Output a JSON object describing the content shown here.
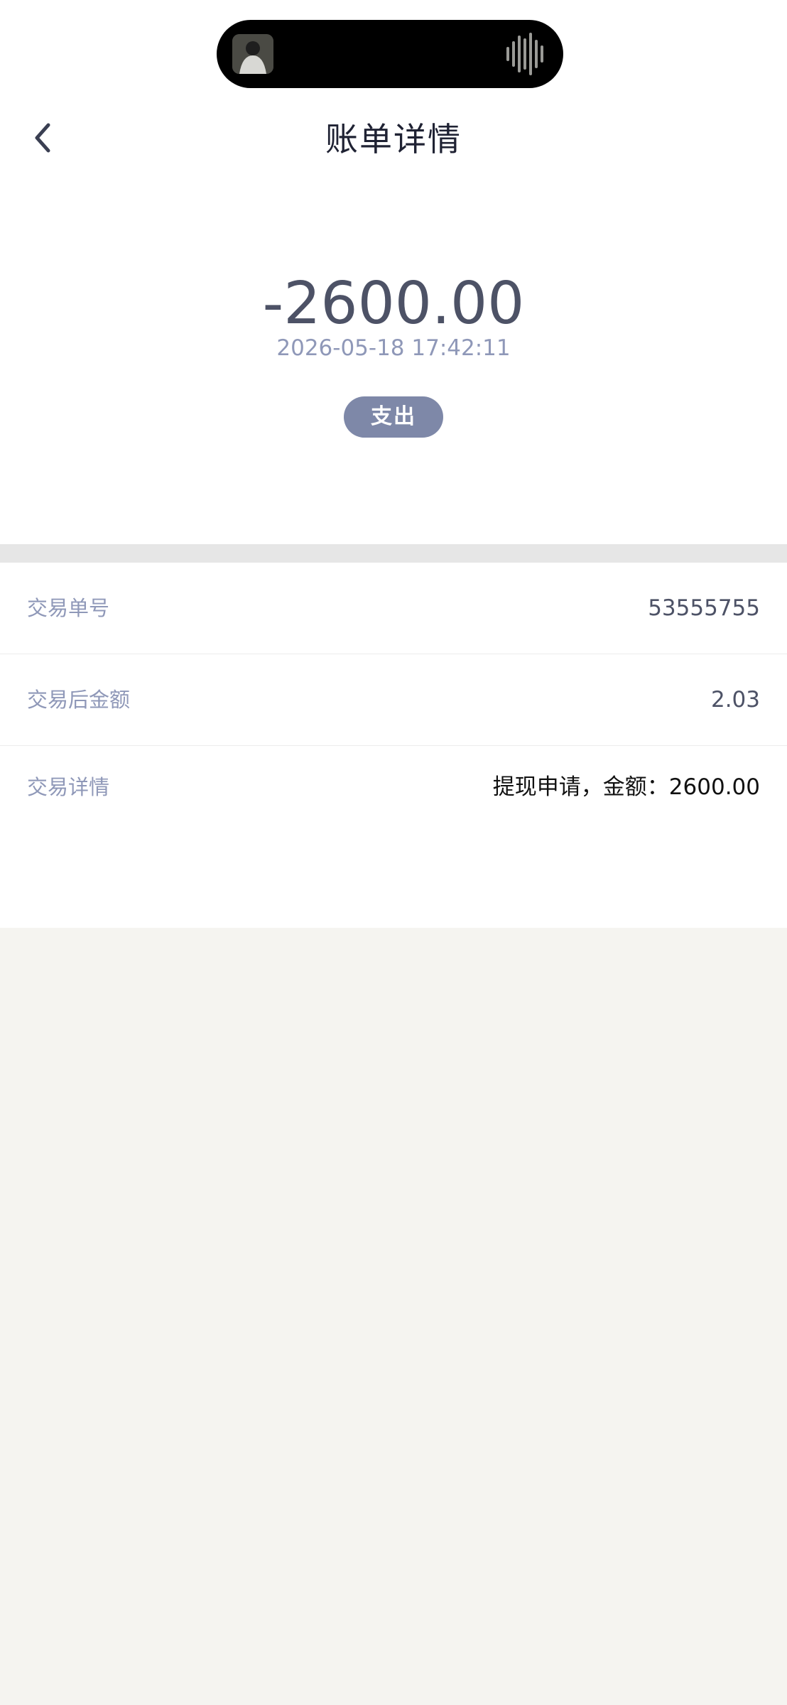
{
  "header": {
    "title": "账单详情"
  },
  "summary": {
    "amount": "-2600.00",
    "datetime": "2026-05-18 17:42:11",
    "type_badge": "支出"
  },
  "details": [
    {
      "label": "交易单号",
      "value": "53555755"
    },
    {
      "label": "交易后金额",
      "value": "2.03"
    },
    {
      "label": "交易详情",
      "value": "提现申请，金额：2600.00"
    }
  ],
  "colors": {
    "title": "#1f2233",
    "amount": "#4d5266",
    "muted": "#8f98b8",
    "badge": "#7e88a8",
    "page_bg": "#f5f4f0"
  },
  "icons": {
    "back": "chevron-left-icon",
    "island_media": "album-thumbnail",
    "island_audio": "audio-wave-icon"
  }
}
